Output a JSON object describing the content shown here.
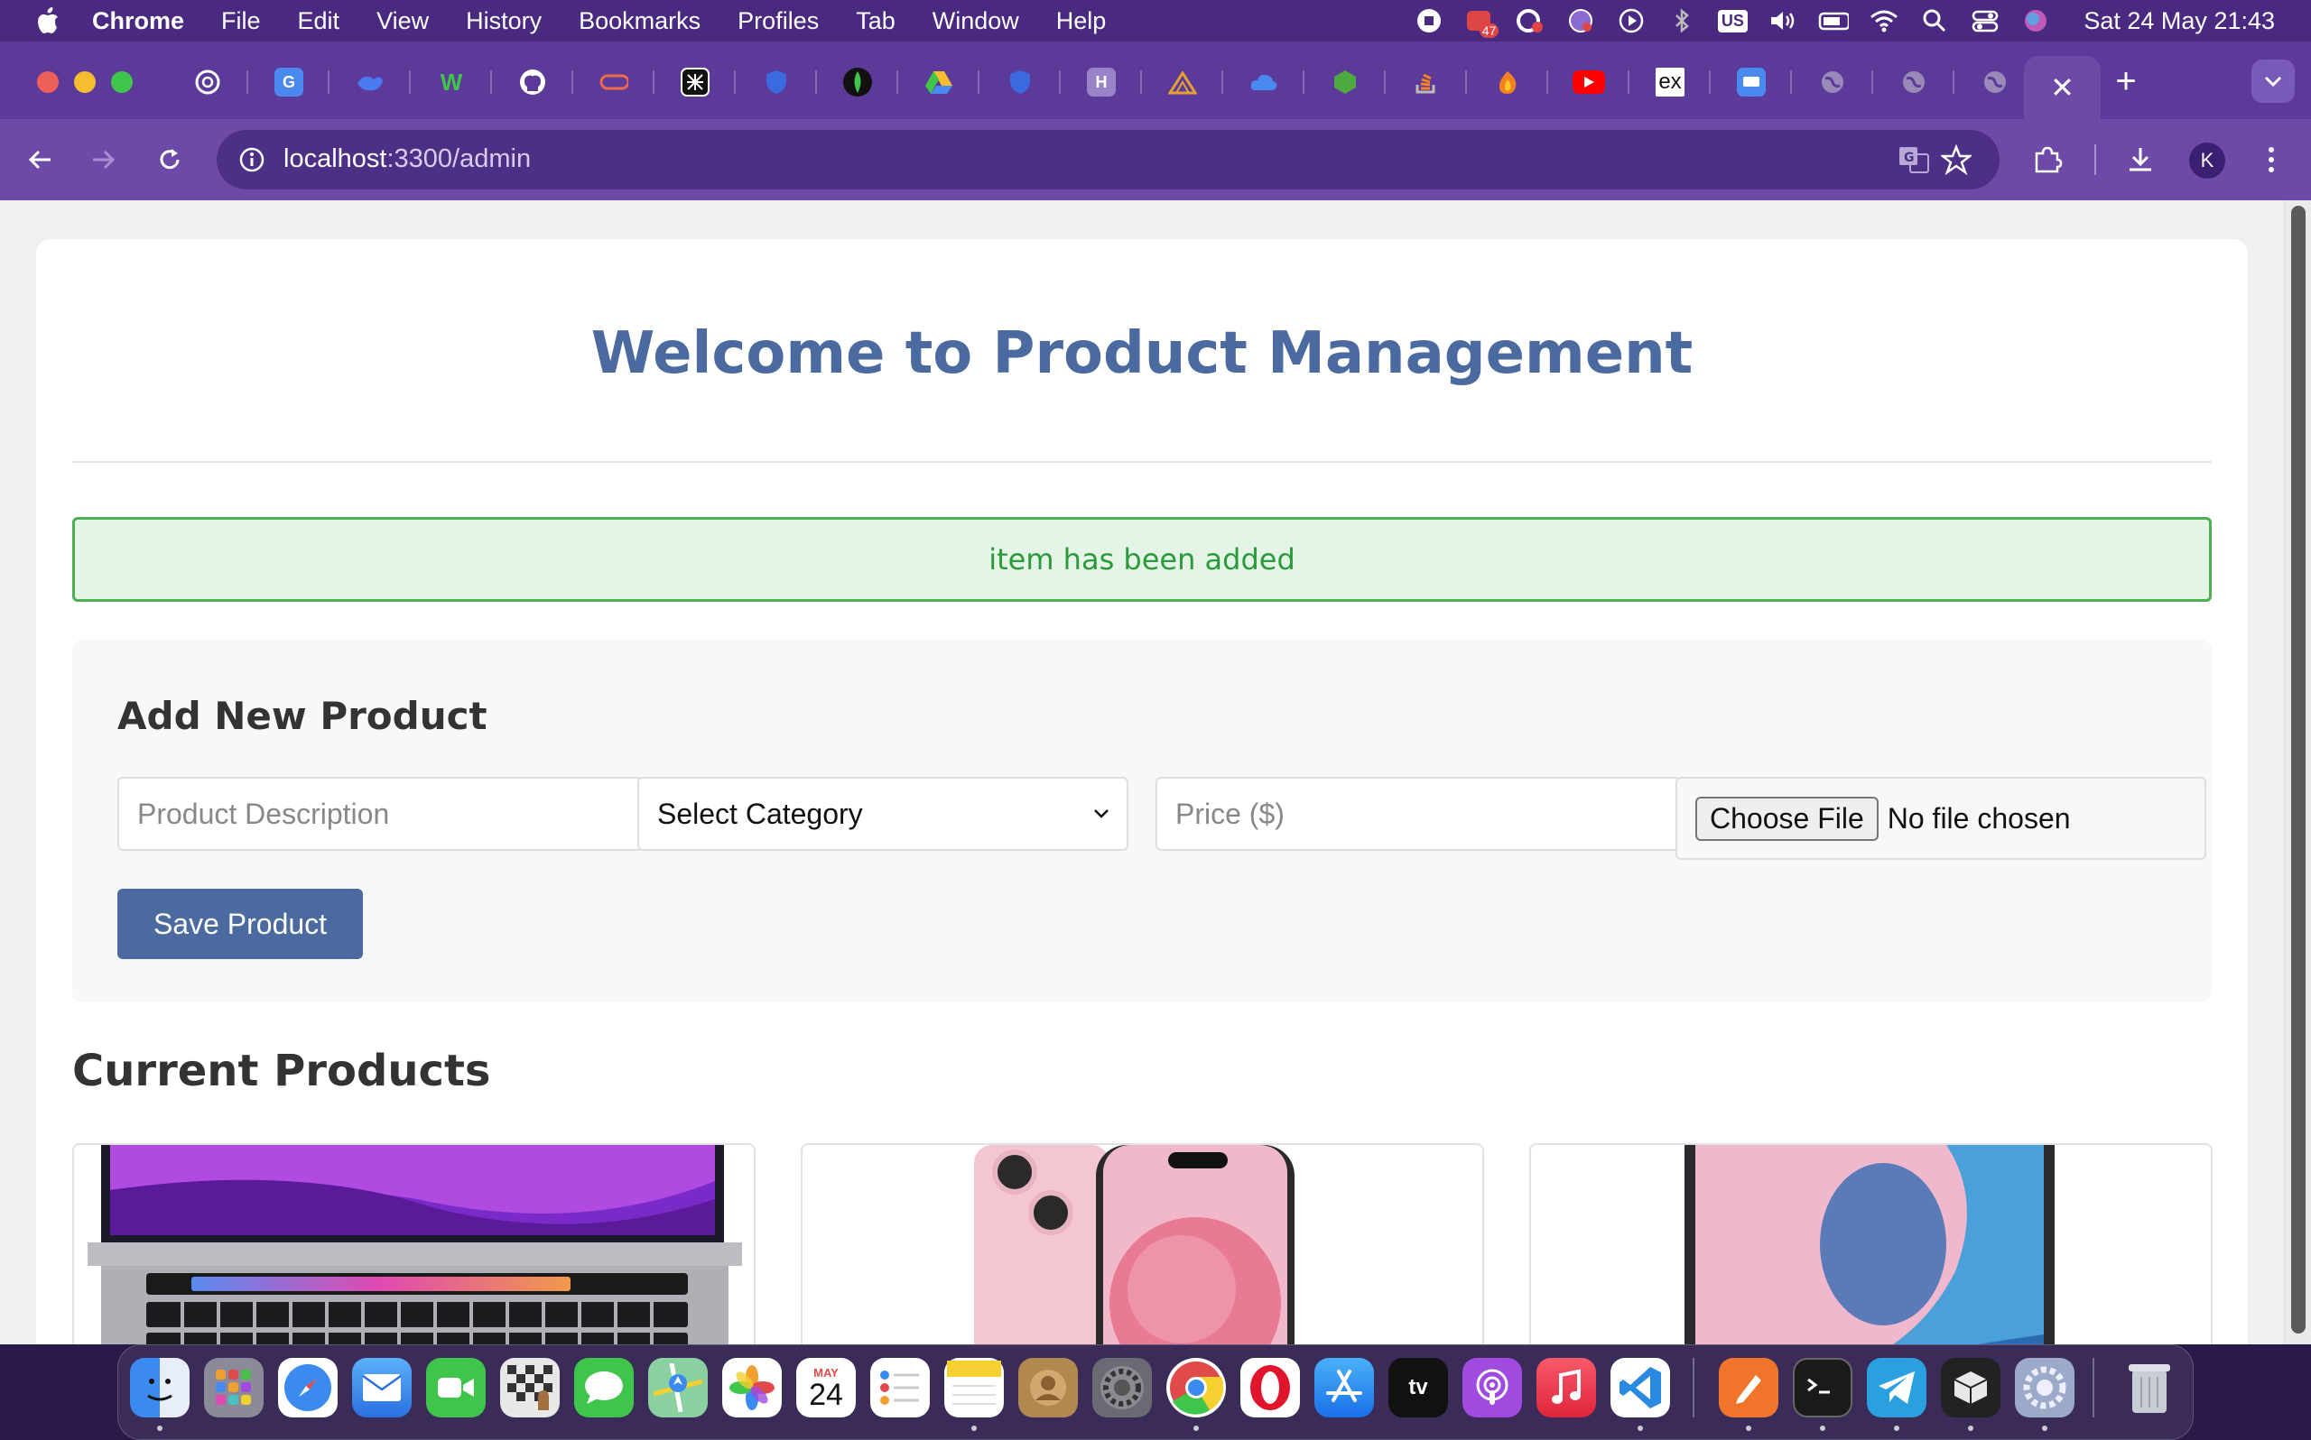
{
  "menubar": {
    "app_name": "Chrome",
    "items": [
      "File",
      "Edit",
      "View",
      "History",
      "Bookmarks",
      "Profiles",
      "Tab",
      "Window",
      "Help"
    ],
    "status_icons": [
      "stop-record-icon",
      "notification-badge-icon",
      "creative-cloud-icon",
      "privacy-icon",
      "play-icon",
      "bluetooth-off-icon",
      "keyboard-us-icon",
      "volume-icon",
      "battery-icon",
      "wifi-icon",
      "spotlight-icon",
      "control-center-icon",
      "siri-icon"
    ],
    "badge_count": "47",
    "input_source": "US",
    "clock": "Sat 24 May  21:43"
  },
  "tabs": {
    "favicons": [
      "chatgpt-icon",
      "translate-icon",
      "deepseek-icon",
      "w-icon",
      "github-icon",
      "oval-icon",
      "notion-icon",
      "shield-icon",
      "mongodb-icon",
      "google-drive-icon",
      "shield-icon",
      "h-icon",
      "tree-icon",
      "cloud-icon",
      "nodejs-icon",
      "stackoverflow-icon",
      "firebase-icon",
      "youtube-icon",
      "ex-icon",
      "screen-icon",
      "globe-icon",
      "globe-icon",
      "globe-icon"
    ],
    "ex_label": "ex",
    "h_label": "H",
    "w_label": "W",
    "active_close": "✕",
    "new_tab": "+"
  },
  "toolbar": {
    "url_host": "localhost",
    "url_path": ":3300/admin",
    "profile_initial": "K"
  },
  "page": {
    "title": "Welcome to Product Management",
    "alert": "item has been added",
    "form": {
      "heading": "Add New Product",
      "description_placeholder": "Product Description",
      "category_selected": "Select Category",
      "price_placeholder": "Price ($)",
      "file_button": "Choose File",
      "file_status": "No file chosen",
      "save_label": "Save Product"
    },
    "products_heading": "Current Products",
    "products": [
      {
        "name": "macbook-product-image"
      },
      {
        "name": "iphone-pink-product-image"
      },
      {
        "name": "ipad-product-image"
      }
    ]
  },
  "dock": {
    "apps": [
      "finder",
      "launchpad",
      "safari",
      "mail",
      "facetime",
      "chess",
      "messages",
      "maps",
      "photos",
      "calendar",
      "reminders",
      "notes",
      "contacts",
      "system-settings",
      "chrome",
      "opera",
      "app-store",
      "apple-tv",
      "podcasts",
      "music",
      "vscode",
      "pen-app",
      "terminal",
      "telegram",
      "box-app",
      "utility",
      "trash"
    ],
    "calendar_month": "MAY",
    "calendar_day": "24",
    "tv_label": "tv"
  }
}
